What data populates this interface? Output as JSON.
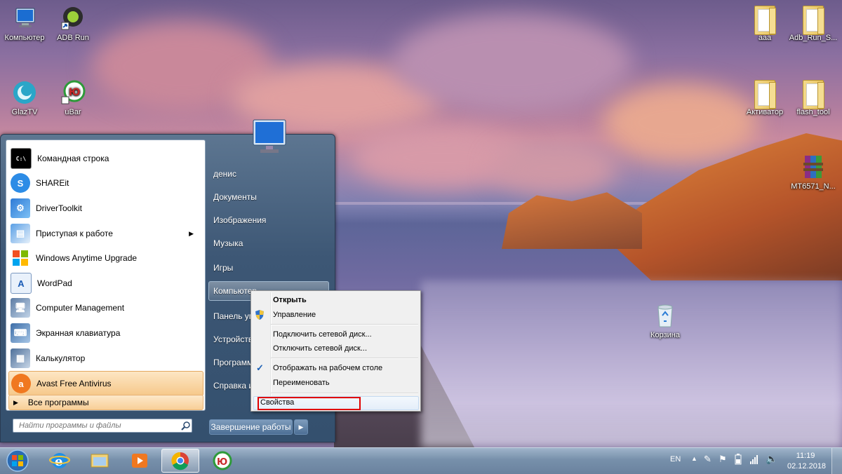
{
  "desktop": {
    "icons_left": [
      {
        "name": "computer-desktop-icon",
        "label": "Компьютер"
      },
      {
        "name": "adb-run-desktop-icon",
        "label": "ADB Run"
      },
      {
        "name": "glaztv-desktop-icon",
        "label": "GlazTV"
      },
      {
        "name": "ubar-desktop-icon",
        "label": "uBar"
      }
    ],
    "icons_right": [
      {
        "label": "aaa"
      },
      {
        "label": "Adb_Run_S..."
      },
      {
        "label": "Активатор"
      },
      {
        "label": "flash_tool"
      },
      {
        "label": "MT6571_N..."
      }
    ],
    "recycle_bin_label": "Корзина"
  },
  "start_menu": {
    "programs": [
      {
        "label": "Командная строка",
        "icon": "cmd-icon"
      },
      {
        "label": "SHAREit",
        "icon": "shareit-icon"
      },
      {
        "label": "DriverToolkit",
        "icon": "drivertoolkit-icon"
      },
      {
        "label": "Приступая к работе",
        "icon": "getting-started-icon"
      },
      {
        "label": "Windows Anytime Upgrade",
        "icon": "windows-upgrade-icon"
      },
      {
        "label": "WordPad",
        "icon": "wordpad-icon"
      },
      {
        "label": "Computer Management",
        "icon": "computer-management-icon"
      },
      {
        "label": "Экранная клавиатура",
        "icon": "onscreen-keyboard-icon"
      },
      {
        "label": "Калькулятор",
        "icon": "calculator-icon"
      },
      {
        "label": "Avast Free Antivirus",
        "icon": "avast-icon"
      }
    ],
    "all_programs_label": "Все программы",
    "search_placeholder": "Найти программы и файлы",
    "right_links": {
      "user": "денис",
      "documents": "Документы",
      "pictures": "Изображения",
      "music": "Музыка",
      "games": "Игры",
      "computer": "Компьютер",
      "control_panel": "Панель уп",
      "devices": "Устройств",
      "default_programs": "Программ",
      "help": "Справка и"
    },
    "shutdown_label": "Завершение работы"
  },
  "context_menu": {
    "items": {
      "open": "Открыть",
      "manage": "Управление",
      "map_drive": "Подключить сетевой диск...",
      "disconnect_drive": "Отключить сетевой диск...",
      "show_on_desktop": "Отображать на рабочем столе",
      "rename": "Переименовать",
      "properties": "Свойства"
    },
    "checked": "show_on_desktop",
    "highlight_color": "#e00000"
  },
  "taskbar": {
    "start_button_icon": "windows-orb-icon",
    "pinned": [
      "ie-icon",
      "explorer-icon",
      "media-player-icon",
      "chrome-icon",
      "ubar-icon"
    ],
    "active": "chrome-icon",
    "tray": {
      "language": "EN"
    },
    "clock": {
      "time": "11:19",
      "date": "02.12.2018"
    }
  }
}
